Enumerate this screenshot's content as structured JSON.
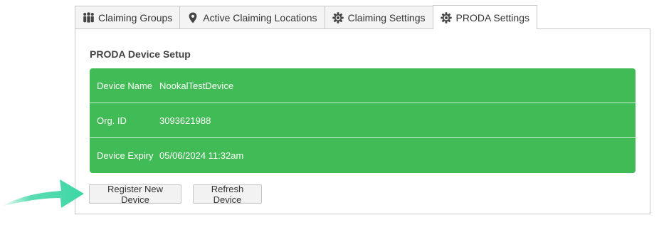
{
  "tabs": [
    {
      "label": "Claiming Groups",
      "icon": "users-icon"
    },
    {
      "label": "Active Claiming Locations",
      "icon": "map-marker-icon"
    },
    {
      "label": "Claiming Settings",
      "icon": "gear-icon"
    },
    {
      "label": "PRODA Settings",
      "icon": "gear-icon"
    }
  ],
  "active_tab": "PRODA Settings",
  "panel": {
    "title": "PRODA Device Setup",
    "rows": [
      {
        "label": "Device Name",
        "value": "NookalTestDevice"
      },
      {
        "label": "Org. ID",
        "value": "3093621988"
      },
      {
        "label": "Device Expiry",
        "value": "05/06/2024 11:32am"
      }
    ],
    "buttons": {
      "register": "Register New Device",
      "refresh": "Refresh Device"
    }
  },
  "colors": {
    "info_box": "#41bb55",
    "arrow": "#3dd6a4"
  }
}
